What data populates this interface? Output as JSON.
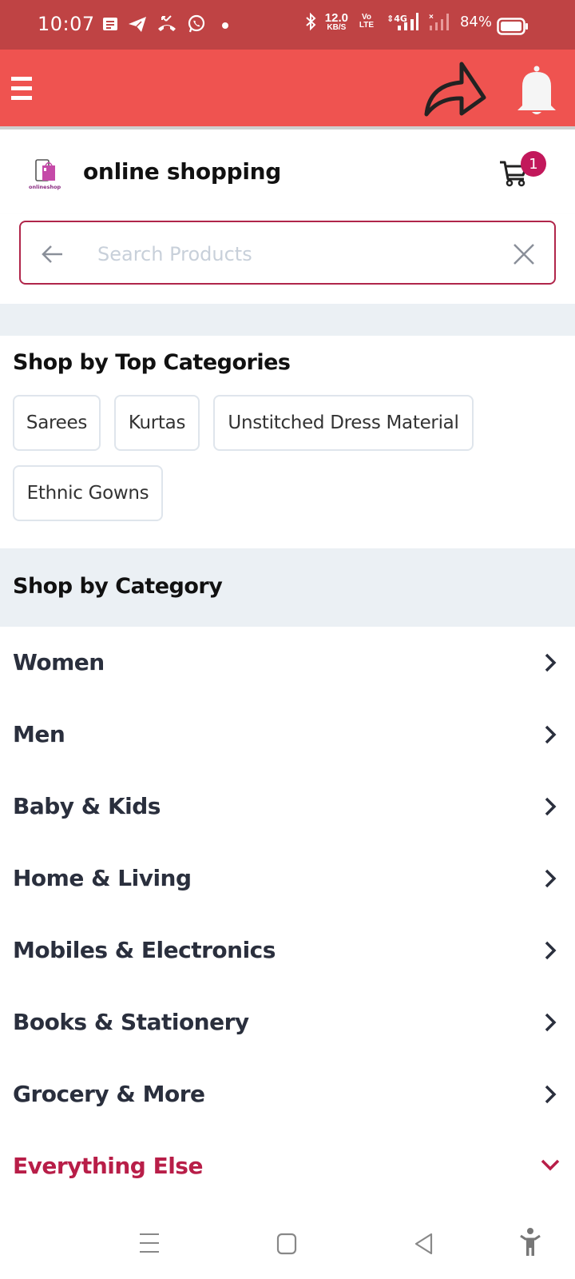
{
  "status_bar": {
    "time": "10:07",
    "notification_icons": [
      "message-icon",
      "telegram-icon",
      "missed-call-icon",
      "whatsapp-icon",
      "dot-icon"
    ],
    "network_speed_value": "12.0",
    "network_speed_unit": "KB/S",
    "volte_label": "Vo LTE",
    "network_type": "4G",
    "battery_percent": "84%"
  },
  "app_bar": {
    "menu_icon": "hamburger-icon",
    "share_icon": "share-arrow-icon",
    "notification_icon": "bell-icon"
  },
  "header": {
    "logo_caption": "onlineshop",
    "title": "online shopping",
    "cart_count": "1"
  },
  "search": {
    "placeholder": "Search Products",
    "value": ""
  },
  "top_categories": {
    "title": "Shop by Top Categories",
    "chips": [
      {
        "label": "Sarees"
      },
      {
        "label": "Kurtas"
      },
      {
        "label": "Unstitched Dress Material"
      },
      {
        "label": "Ethnic Gowns"
      }
    ]
  },
  "categories": {
    "title": "Shop by Category",
    "items": [
      {
        "label": "Women",
        "state": "collapsed"
      },
      {
        "label": "Men",
        "state": "collapsed"
      },
      {
        "label": "Baby & Kids",
        "state": "collapsed"
      },
      {
        "label": "Home & Living",
        "state": "collapsed"
      },
      {
        "label": "Mobiles & Electronics",
        "state": "collapsed"
      },
      {
        "label": "Books & Stationery",
        "state": "collapsed"
      },
      {
        "label": "Grocery & More",
        "state": "collapsed"
      },
      {
        "label": "Everything Else",
        "state": "expanded"
      }
    ]
  },
  "colors": {
    "status_bar": "#bf4344",
    "app_bar": "#ef5350",
    "accent": "#b81e48",
    "badge": "#c2185b",
    "section_band": "#ebf0f4",
    "text_dark": "#2a2f3d"
  },
  "nav_bar": {
    "buttons": [
      "recents-icon",
      "home-icon",
      "back-icon",
      "accessibility-icon"
    ]
  }
}
